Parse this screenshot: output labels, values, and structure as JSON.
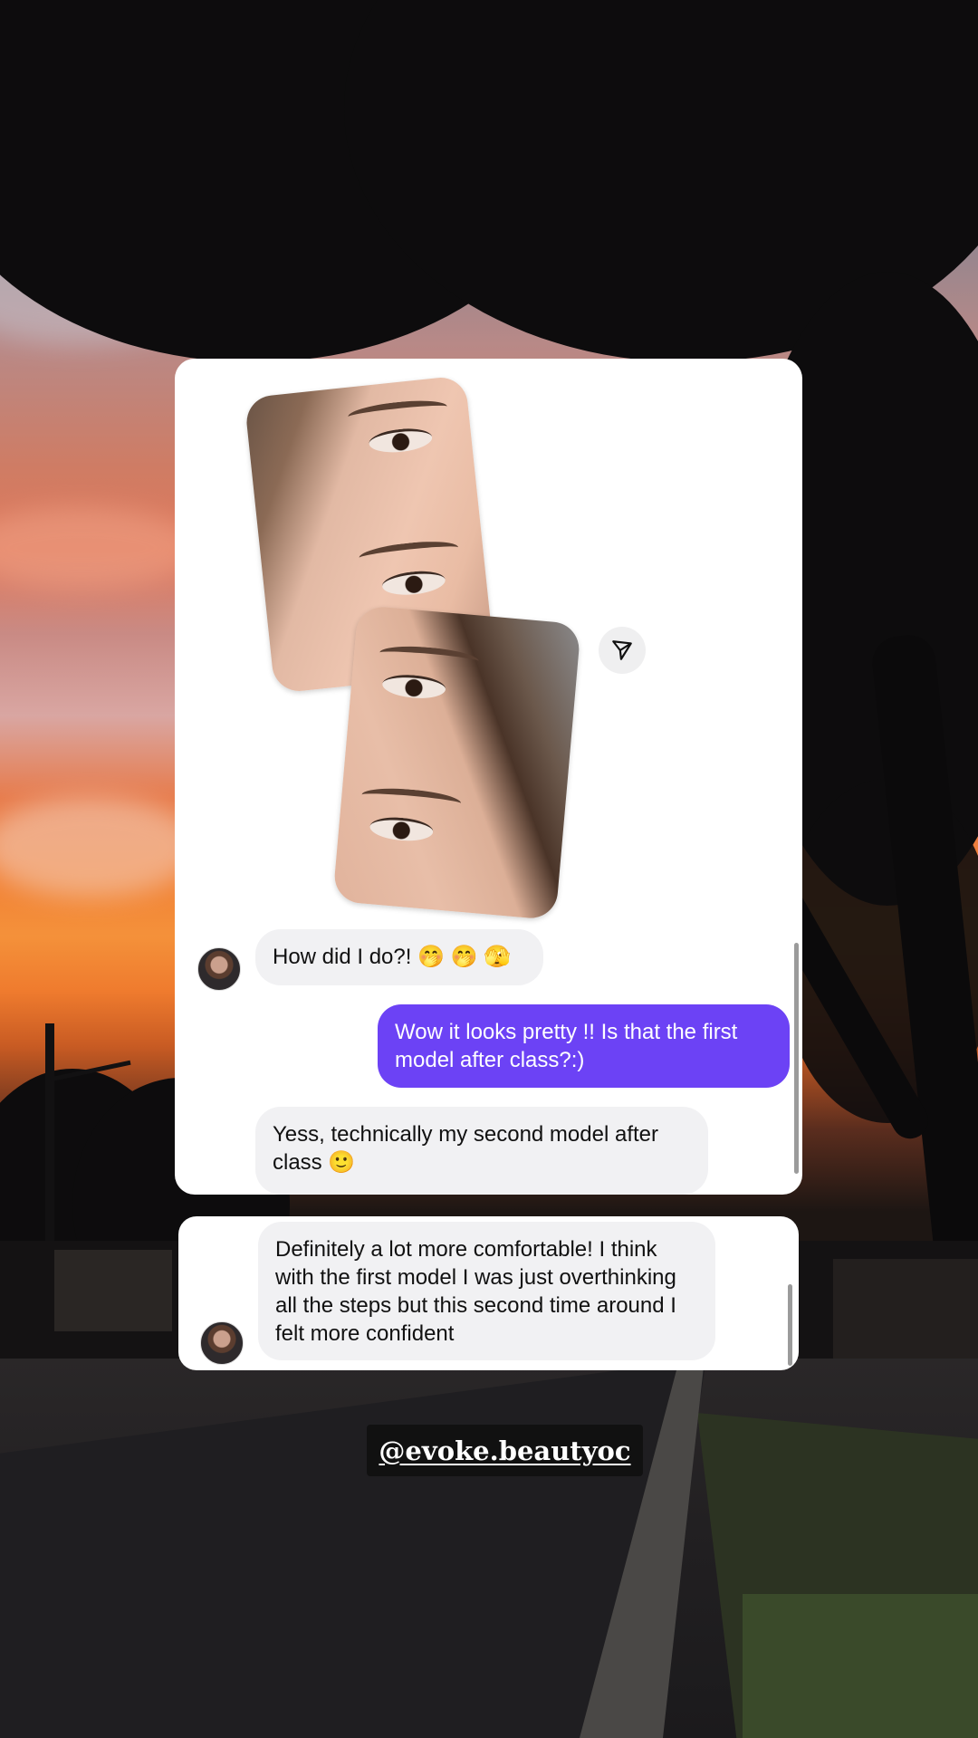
{
  "messages": [
    {
      "id": "m1",
      "direction": "incoming",
      "text": "How did I do?! 🤭 🤭 🫣"
    },
    {
      "id": "m2",
      "direction": "outgoing",
      "text": "Wow it looks pretty !! Is that the first model after class?:)"
    },
    {
      "id": "m3",
      "direction": "incoming",
      "text": "Yess, technically my second model after class 🙂"
    },
    {
      "id": "m4",
      "direction": "incoming",
      "text": "Definitely a lot more comfortable! I think with the first model I was just overthinking all the steps but this second time around I felt more confident"
    }
  ],
  "handle": "@evoke.beautyoc",
  "icons": {
    "send": "paper-plane-icon",
    "avatar": "avatar"
  },
  "colors": {
    "outgoing_bubble": "#6c42f5",
    "incoming_bubble": "#f1f1f3",
    "card_bg": "#ffffff",
    "handle_bg": "#111111"
  }
}
